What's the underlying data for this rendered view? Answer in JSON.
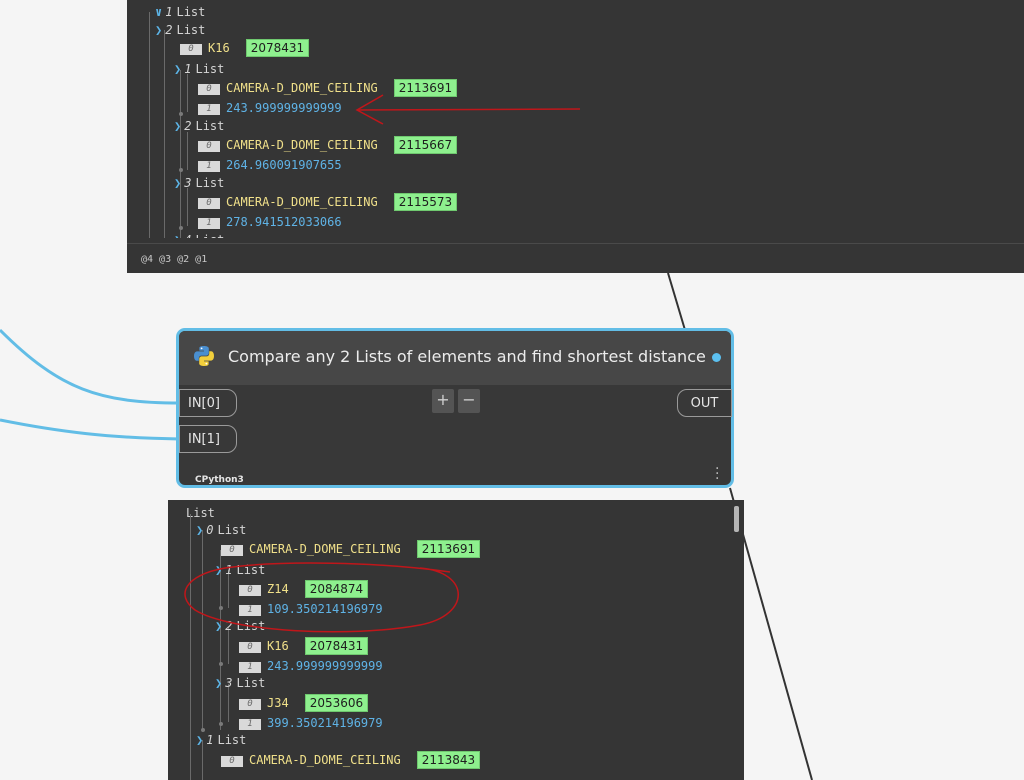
{
  "node": {
    "title": "Compare any 2 Lists of elements and find shortest distance",
    "inputs": [
      "IN[0]",
      "IN[1]"
    ],
    "output": "OUT",
    "add_label": "+",
    "remove_label": "−",
    "engine": "CPython3",
    "icon": "python-icon",
    "state_color": "#5cc0f0"
  },
  "top_watch": {
    "footer": "@4 @3 @2 @1",
    "items": [
      {
        "type": "list",
        "index": "1",
        "label": "List",
        "chevron": "v"
      },
      {
        "type": "list",
        "index": "2",
        "label": "List",
        "chevron": ">"
      },
      {
        "type": "item",
        "index": "0",
        "value": "K16",
        "vclass": "name",
        "tag": "2078431"
      },
      {
        "type": "list",
        "index": "1",
        "label": "List",
        "chevron": ">"
      },
      {
        "type": "item",
        "index": "0",
        "value": "CAMERA-D_DOME_CEILING",
        "vclass": "name",
        "tag": "2113691"
      },
      {
        "type": "item",
        "index": "1",
        "value": "243.999999999999",
        "vclass": "num"
      },
      {
        "type": "list",
        "index": "2",
        "label": "List",
        "chevron": ">"
      },
      {
        "type": "item",
        "index": "0",
        "value": "CAMERA-D_DOME_CEILING",
        "vclass": "name",
        "tag": "2115667"
      },
      {
        "type": "item",
        "index": "1",
        "value": "264.960091907655",
        "vclass": "num"
      },
      {
        "type": "list",
        "index": "3",
        "label": "List",
        "chevron": ">"
      },
      {
        "type": "item",
        "index": "0",
        "value": "CAMERA-D_DOME_CEILING",
        "vclass": "name",
        "tag": "2115573"
      },
      {
        "type": "item",
        "index": "1",
        "value": "278.941512033066",
        "vclass": "num"
      },
      {
        "type": "list",
        "index": "4",
        "label": "List",
        "chevron": ">"
      }
    ]
  },
  "bottom_watch": {
    "root": "List",
    "items": [
      {
        "type": "list",
        "index": "0",
        "label": "List",
        "chevron": ">"
      },
      {
        "type": "item",
        "index": "0",
        "value": "CAMERA-D_DOME_CEILING",
        "vclass": "name",
        "tag": "2113691"
      },
      {
        "type": "list",
        "index": "1",
        "label": "List",
        "chevron": ">"
      },
      {
        "type": "item",
        "index": "0",
        "value": "Z14",
        "vclass": "name",
        "tag": "2084874"
      },
      {
        "type": "item",
        "index": "1",
        "value": "109.350214196979",
        "vclass": "num"
      },
      {
        "type": "list",
        "index": "2",
        "label": "List",
        "chevron": ">"
      },
      {
        "type": "item",
        "index": "0",
        "value": "K16",
        "vclass": "name",
        "tag": "2078431"
      },
      {
        "type": "item",
        "index": "1",
        "value": "243.999999999999",
        "vclass": "num"
      },
      {
        "type": "list",
        "index": "3",
        "label": "List",
        "chevron": ">"
      },
      {
        "type": "item",
        "index": "0",
        "value": "J34",
        "vclass": "name",
        "tag": "2053606"
      },
      {
        "type": "item",
        "index": "1",
        "value": "399.350214196979",
        "vclass": "num"
      },
      {
        "type": "list",
        "index": "1",
        "label": "List",
        "chevron": ">"
      },
      {
        "type": "item",
        "index": "0",
        "value": "CAMERA-D_DOME_CEILING",
        "vclass": "name",
        "tag": "2113843"
      }
    ]
  },
  "colors": {
    "canvas": "#f5f5f5",
    "wire": "#62bde6",
    "panel": "#353535",
    "tag": "#8ef08e",
    "annotation": "#c0161a"
  }
}
